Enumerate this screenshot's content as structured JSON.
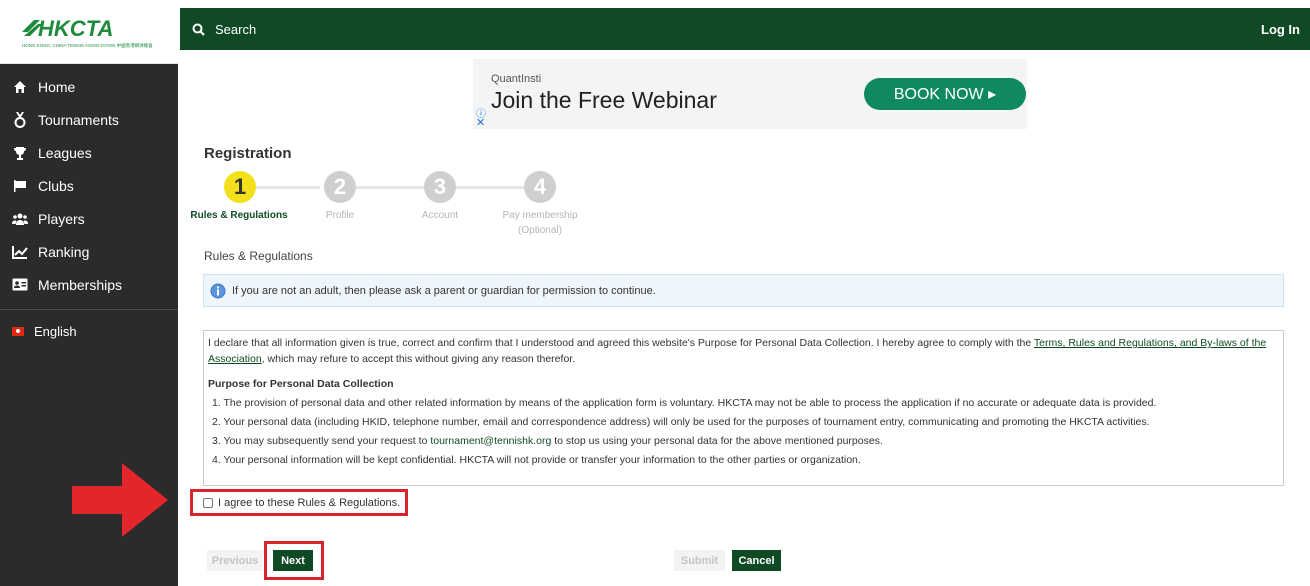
{
  "logo": {
    "title": "HKCTA",
    "subtitle": "HONG KONG, CHINA TENNIS ASSOCIATION 中國香港網球總會"
  },
  "sidebar": {
    "items": [
      {
        "label": "Home",
        "icon": "home-icon"
      },
      {
        "label": "Tournaments",
        "icon": "medal-icon"
      },
      {
        "label": "Leagues",
        "icon": "trophy-icon"
      },
      {
        "label": "Clubs",
        "icon": "flag-icon"
      },
      {
        "label": "Players",
        "icon": "players-icon"
      },
      {
        "label": "Ranking",
        "icon": "chart-line-icon"
      },
      {
        "label": "Memberships",
        "icon": "id-card-icon"
      }
    ],
    "language": "English"
  },
  "topbar": {
    "search_label": "Search",
    "login_label": "Log In"
  },
  "ad": {
    "brand": "QuantInsti",
    "headline": "Join the Free Webinar",
    "cta": "BOOK NOW ▸",
    "info": "ⓘ",
    "close": "✕"
  },
  "registration": {
    "title": "Registration",
    "steps": [
      {
        "number": "1",
        "label": "Rules & Regulations",
        "active": true
      },
      {
        "number": "2",
        "label": "Profile",
        "active": false
      },
      {
        "number": "3",
        "label": "Account",
        "active": false
      },
      {
        "number": "4",
        "label": "Pay membership (Optional)",
        "active": false
      }
    ],
    "section_label": "Rules & Regulations",
    "info_message": "If you are not an adult, then please ask a parent or guardian for permission to continue.",
    "declaration_pre": "I declare that all information given is true, correct and confirm that I understood and agreed this website's Purpose for Personal Data Collection. I hereby agree to comply with the ",
    "declaration_link": "Terms, Rules and Regulations, and By-laws of the Association",
    "declaration_post": ", which may refure to accept this without giving any reason therefor.",
    "purpose_heading": "Purpose for Personal Data Collection",
    "purpose_1": "1. The provision of personal data and other related information by means of the application form is voluntary. HKCTA may not be able to process the application if no accurate or adequate data is provided.",
    "purpose_2": "2. Your personal data (including HKID, telephone number, email and correspondence address) will only be used for the purposes of tournament entry, communicating and promoting the HKCTA activities.",
    "purpose_3_pre": "3. You may subsequently send your request to ",
    "purpose_3_email": "tournament@tennishk.org",
    "purpose_3_post": " to stop us using your personal data for the above mentioned purposes.",
    "purpose_4": "4. Your personal information will be kept confidential. HKCTA will not provide or transfer your information to the other parties or organization.",
    "agree_label": "I agree to these Rules & Regulations.",
    "agree_checked": false
  },
  "buttons": {
    "previous": "Previous",
    "next": "Next",
    "submit": "Submit",
    "cancel": "Cancel"
  },
  "colors": {
    "brand_green": "#0f4a24",
    "sidebar_bg": "#2b2b2b",
    "step_active": "#f3e01b",
    "highlight_red": "#d7262b",
    "ad_cta": "#0f8a5f"
  }
}
